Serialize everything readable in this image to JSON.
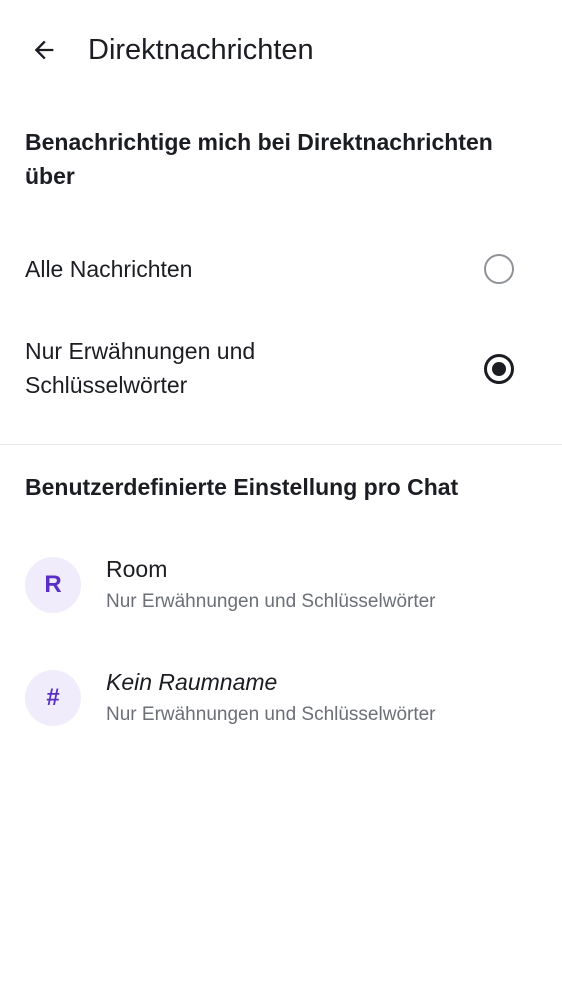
{
  "header": {
    "title": "Direktnachrichten",
    "back_icon": "arrow-left-icon"
  },
  "notify_section": {
    "heading": "Benachrichtige mich bei Direktnachrichten über",
    "options": [
      {
        "label": "Alle Nachrichten",
        "selected": false
      },
      {
        "label": "Nur Erwähnungen und Schlüsselwörter",
        "selected": true
      }
    ]
  },
  "custom_section": {
    "heading": "Benutzerdefinierte Einstellung pro Chat",
    "chats": [
      {
        "avatar": "R",
        "name": "Room",
        "setting": "Nur Erwähnungen und Schlüsselwörter",
        "name_italic": false
      },
      {
        "avatar": "#",
        "name": "Kein Raumname",
        "setting": "Nur Erwähnungen und Schlüsselwörter",
        "name_italic": true
      }
    ]
  },
  "colors": {
    "text": "#1b1d22",
    "secondary_text": "#6b6f76",
    "avatar_bg": "#f0ecfb",
    "avatar_fg": "#5a2ec4",
    "radio_off": "#8e9297"
  }
}
